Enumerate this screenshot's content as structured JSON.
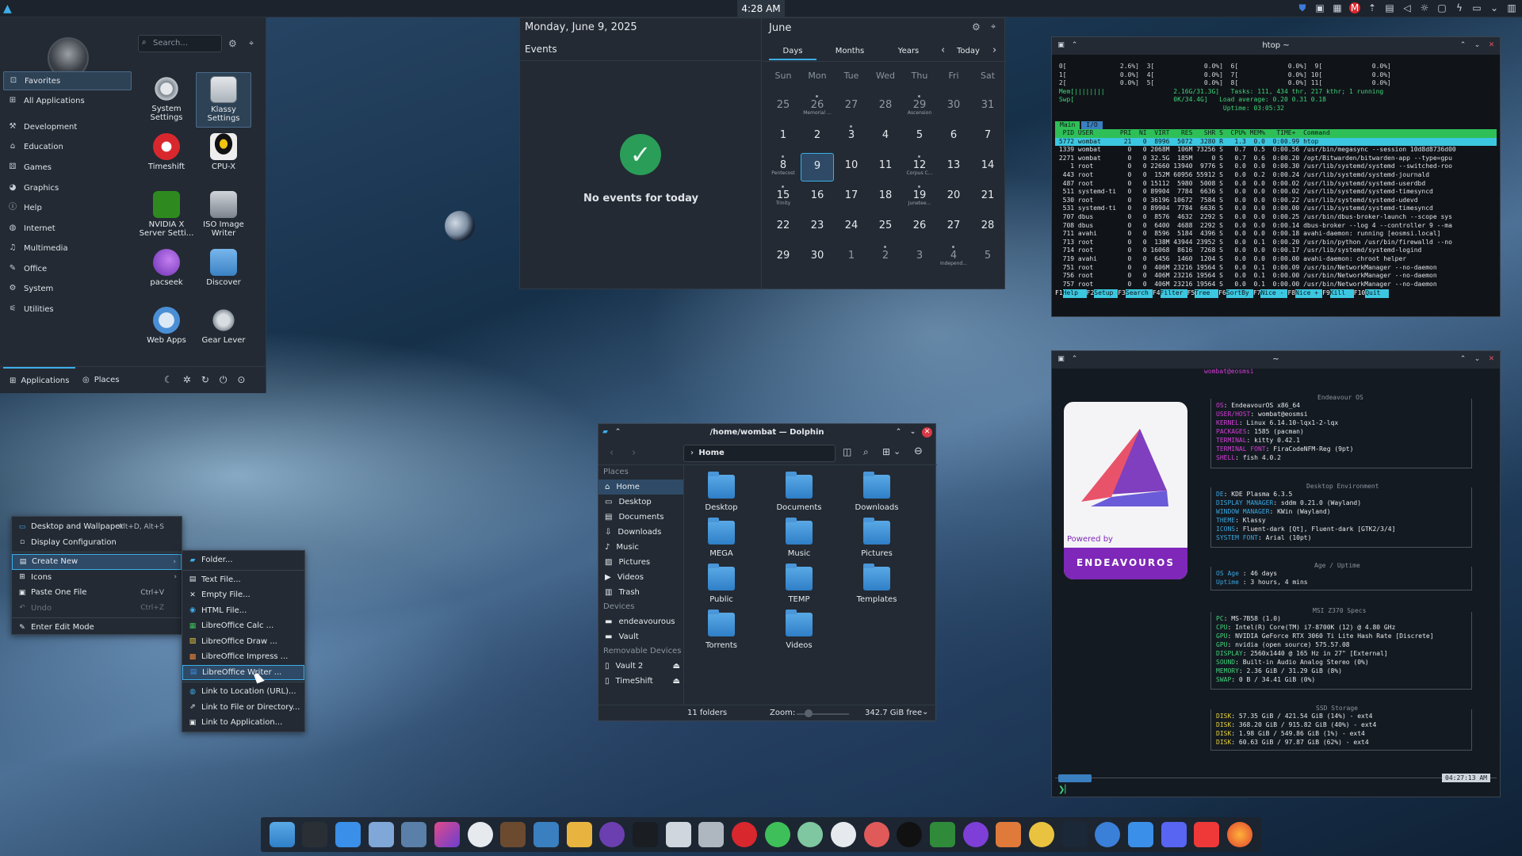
{
  "topbar": {
    "clock": "4:28 AM"
  },
  "launcher": {
    "search_placeholder": "Search...",
    "categories": [
      "Favorites",
      "All Applications",
      "Development",
      "Education",
      "Games",
      "Graphics",
      "Help",
      "Internet",
      "Multimedia",
      "Office",
      "System",
      "Utilities"
    ],
    "apps": [
      "System Settings",
      "Klassy Settings",
      "Timeshift",
      "CPU-X",
      "NVIDIA X Server Setti...",
      "ISO Image Writer",
      "pacseek",
      "Discover",
      "Web Apps",
      "Gear Lever"
    ],
    "tabs": [
      "Applications",
      "Places"
    ]
  },
  "calendar": {
    "date_heading": "Monday, June 9, 2025",
    "events_label": "Events",
    "no_events": "No events for today",
    "month": "June",
    "views": [
      "Days",
      "Months",
      "Years"
    ],
    "today_label": "Today",
    "weekdays": [
      "Sun",
      "Mon",
      "Tue",
      "Wed",
      "Thu",
      "Fri",
      "Sat"
    ],
    "weeks": [
      [
        "25",
        "26",
        "27",
        "28",
        "29",
        "30",
        "31"
      ],
      [
        "1",
        "2",
        "3",
        "4",
        "5",
        "6",
        "7"
      ],
      [
        "8",
        "9",
        "10",
        "11",
        "12",
        "13",
        "14"
      ],
      [
        "15",
        "16",
        "17",
        "18",
        "19",
        "20",
        "21"
      ],
      [
        "22",
        "23",
        "24",
        "25",
        "26",
        "27",
        "28"
      ],
      [
        "29",
        "30",
        "1",
        "2",
        "3",
        "4",
        "5"
      ]
    ],
    "holidays": {
      "memorial": "Memorial ...",
      "ascension": "Ascension",
      "pentecost": "Pentecost",
      "corpus": "Corpus C...",
      "trinity": "Trinity",
      "juneteenth": "Junetee...",
      "independence": "Independ..."
    }
  },
  "htop": {
    "title": "htop ~",
    "cpu_lines": [
      " 0[              2.6%]  3[             0.0%]  6[             0.0%]  9[             0.0%]",
      " 1[              0.0%]  4[             0.0%]  7[             0.0%] 10[             0.0%]",
      " 2[              0.0%]  5[             0.0%]  8[             0.0%] 11[             0.0%]",
      " Mem[||||||||                  2.16G/31.3G]   Tasks: 111, 434 thr, 217 kthr; 1 running",
      " Swp[                          0K/34.4G]   Load average: 0.20 0.31 0.18",
      "                                            Uptime: 03:05:32"
    ],
    "tabs": [
      "Main",
      "I/O"
    ],
    "header": "  PID USER       PRI  NI  VIRT   RES   SHR S  CPU% MEM%   TIME+  Command",
    "rows": [
      " 5772 wombat      21   0  8996  5072  3280 R   1.3  0.0  0:00.99 htop",
      " 1339 wombat       0   0 2068M  106M 73256 S   0.7  0.5  0:00.56 /usr/bin/megasync --session 10d8d8736d00",
      " 2271 wombat       0   0 32.5G  185M     0 S   0.7  0.6  0:00.20 /opt/Bitwarden/bitwarden-app --type=gpu",
      "    1 root         0   0 22660 13940  9776 S   0.0  0.0  0:00.30 /usr/lib/systemd/systemd --switched-roo",
      "  443 root         0   0  152M 60956 55912 S   0.0  0.2  0:00.24 /usr/lib/systemd/systemd-journald",
      "  487 root         0   0 15112  5980  5008 S   0.0  0.0  0:00.02 /usr/lib/systemd/systemd-userdbd",
      "  511 systemd-ti   0   0 89904  7784  6636 S   0.0  0.0  0:00.02 /usr/lib/systemd/systemd-timesyncd",
      "  530 root         0   0 36196 10672  7584 S   0.0  0.0  0:00.22 /usr/lib/systemd/systemd-udevd",
      "  531 systemd-ti   0   0 89904  7784  6636 S   0.0  0.0  0:00.00 /usr/lib/systemd/systemd-timesyncd",
      "  707 dbus         0   0  8576  4632  2292 S   0.0  0.0  0:00.25 /usr/bin/dbus-broker-launch --scope sys",
      "  708 dbus         0   0  6400  4688  2292 S   0.0  0.0  0:00.14 dbus-broker --log 4 --controller 9 --ma",
      "  711 avahi        0   0  8596  5184  4396 S   0.0  0.0  0:00.18 avahi-daemon: running [eosmsi.local]",
      "  713 root         0   0  138M 43944 23952 S   0.0  0.1  0:00.20 /usr/bin/python /usr/bin/firewalld --no",
      "  714 root         0   0 16068  8616  7268 S   0.0  0.0  0:00.17 /usr/lib/systemd/systemd-logind",
      "  719 avahi        0   0  6456  1460  1204 S   0.0  0.0  0:00.00 avahi-daemon: chroot helper",
      "  751 root         0   0  406M 23216 19564 S   0.0  0.1  0:00.09 /usr/bin/NetworkManager --no-daemon",
      "  756 root         0   0  406M 23216 19564 S   0.0  0.1  0:00.00 /usr/bin/NetworkManager --no-daemon",
      "  757 root         0   0  406M 23216 19564 S   0.0  0.1  0:00.00 /usr/bin/NetworkManager --no-daemon"
    ],
    "fkeys": [
      [
        "F1",
        "Help"
      ],
      [
        "F2",
        "Setup"
      ],
      [
        "F3",
        "Search"
      ],
      [
        "F4",
        "Filter"
      ],
      [
        "F5",
        "Tree"
      ],
      [
        "F6",
        "SortBy"
      ],
      [
        "F7",
        "Nice -"
      ],
      [
        "F8",
        "Nice +"
      ],
      [
        "F9",
        "Kill"
      ],
      [
        "F10",
        "Quit"
      ]
    ]
  },
  "dolphin": {
    "title": "/home/wombat — Dolphin",
    "breadcrumb": "Home",
    "places_header": "Places",
    "places": [
      "Home",
      "Desktop",
      "Documents",
      "Downloads",
      "Music",
      "Pictures",
      "Videos",
      "Trash"
    ],
    "devices_header": "Devices",
    "devices": [
      "endeavourous",
      "Vault"
    ],
    "removable_header": "Removable Devices",
    "removable": [
      "Vault 2",
      "TimeShift"
    ],
    "folders": [
      "Desktop",
      "Documents",
      "Downloads",
      "MEGA",
      "Music",
      "Pictures",
      "Public",
      "TEMP",
      "Templates",
      "Torrents",
      "Videos"
    ],
    "status": "11 folders",
    "zoom_label": "Zoom:",
    "free_space": "342.7 GiB free"
  },
  "context_menu": {
    "items": [
      {
        "label": "Desktop and Wallpaper",
        "shortcut": "Alt+D, Alt+S"
      },
      {
        "label": "Display Configuration",
        "shortcut": ""
      },
      {
        "label": "Create New",
        "shortcut": ""
      },
      {
        "label": "Icons",
        "shortcut": ""
      },
      {
        "label": "Paste One File",
        "shortcut": "Ctrl+V"
      },
      {
        "label": "Undo",
        "shortcut": "Ctrl+Z"
      },
      {
        "label": "Enter Edit Mode",
        "shortcut": ""
      }
    ],
    "submenu": [
      "Folder...",
      "Text File...",
      "Empty File...",
      "HTML File...",
      "LibreOffice Calc ...",
      "LibreOffice Draw ...",
      "LibreOffice Impress ...",
      "LibreOffice Writer ...",
      "Link to Location (URL)...",
      "Link to File or Directory...",
      "Link to Application..."
    ]
  },
  "terminal": {
    "title": "~",
    "user_host": "wombat@eosmsi",
    "logo_caption": "Powered by",
    "logo_text": "ENDEAVOUROS",
    "sections": [
      {
        "head": "Endeavour OS",
        "lines": [
          [
            "OS",
            "EndeavourOS x86_64"
          ],
          [
            "USER/HOST",
            "wombat@eosmsi"
          ],
          [
            "KERNEL",
            "Linux 6.14.10-lqx1-2-lqx"
          ],
          [
            "PACKAGES",
            "1585 (pacman)"
          ],
          [
            "TERMINAL",
            "kitty 0.42.1"
          ],
          [
            "TERMINAL FONT",
            "FiraCodeNFM-Reg (9pt)"
          ],
          [
            "SHELL",
            "fish 4.0.2"
          ]
        ]
      },
      {
        "head": "Desktop Environment",
        "lines": [
          [
            "DE",
            "KDE Plasma 6.3.5"
          ],
          [
            "DISPLAY MANAGER",
            "sddm 0.21.0 (Wayland)"
          ],
          [
            "WINDOW MANAGER",
            "KWin (Wayland)"
          ],
          [
            "THEME",
            "Klassy"
          ],
          [
            "ICONS",
            "Fluent-dark [Qt], Fluent-dark [GTK2/3/4]"
          ],
          [
            "SYSTEM FONT",
            "Arial (10pt)"
          ]
        ]
      },
      {
        "head": "Age / Uptime",
        "lines": [
          [
            "OS Age",
            "46 days"
          ],
          [
            "Uptime",
            "3 hours, 4 mins"
          ]
        ]
      },
      {
        "head": "MSI Z370 Specs",
        "lines": [
          [
            "PC",
            "MS-7B58 (1.0)"
          ],
          [
            "CPU",
            "Intel(R) Core(TM) i7-8700K (12) @ 4.80 GHz"
          ],
          [
            "GPU",
            "NVIDIA GeForce RTX 3060 Ti Lite Hash Rate [Discrete]"
          ],
          [
            "GPU",
            "nvidia (open source) 575.57.08"
          ],
          [
            "DISPLAY",
            "2560x1440 @ 165 Hz in 27\" [External]"
          ],
          [
            "SOUND",
            "Built-in Audio Analog Stereo (0%)"
          ],
          [
            "MEMORY",
            "2.36 GiB / 31.29 GiB (8%)"
          ],
          [
            "SWAP",
            "0 B / 34.41 GiB (0%)"
          ]
        ]
      },
      {
        "head": "SSD Storage",
        "lines": [
          [
            "DISK",
            "57.35 GiB / 421.54 GiB (14%) - ext4"
          ],
          [
            "DISK",
            "368.20 GiB / 915.82 GiB (40%) - ext4"
          ],
          [
            "DISK",
            "1.98 GiB / 549.86 GiB (1%) - ext4"
          ],
          [
            "DISK",
            "60.63 GiB / 97.87 GiB (62%) - ext4"
          ]
        ]
      }
    ],
    "prompt_time": "04:27:13 AM"
  }
}
